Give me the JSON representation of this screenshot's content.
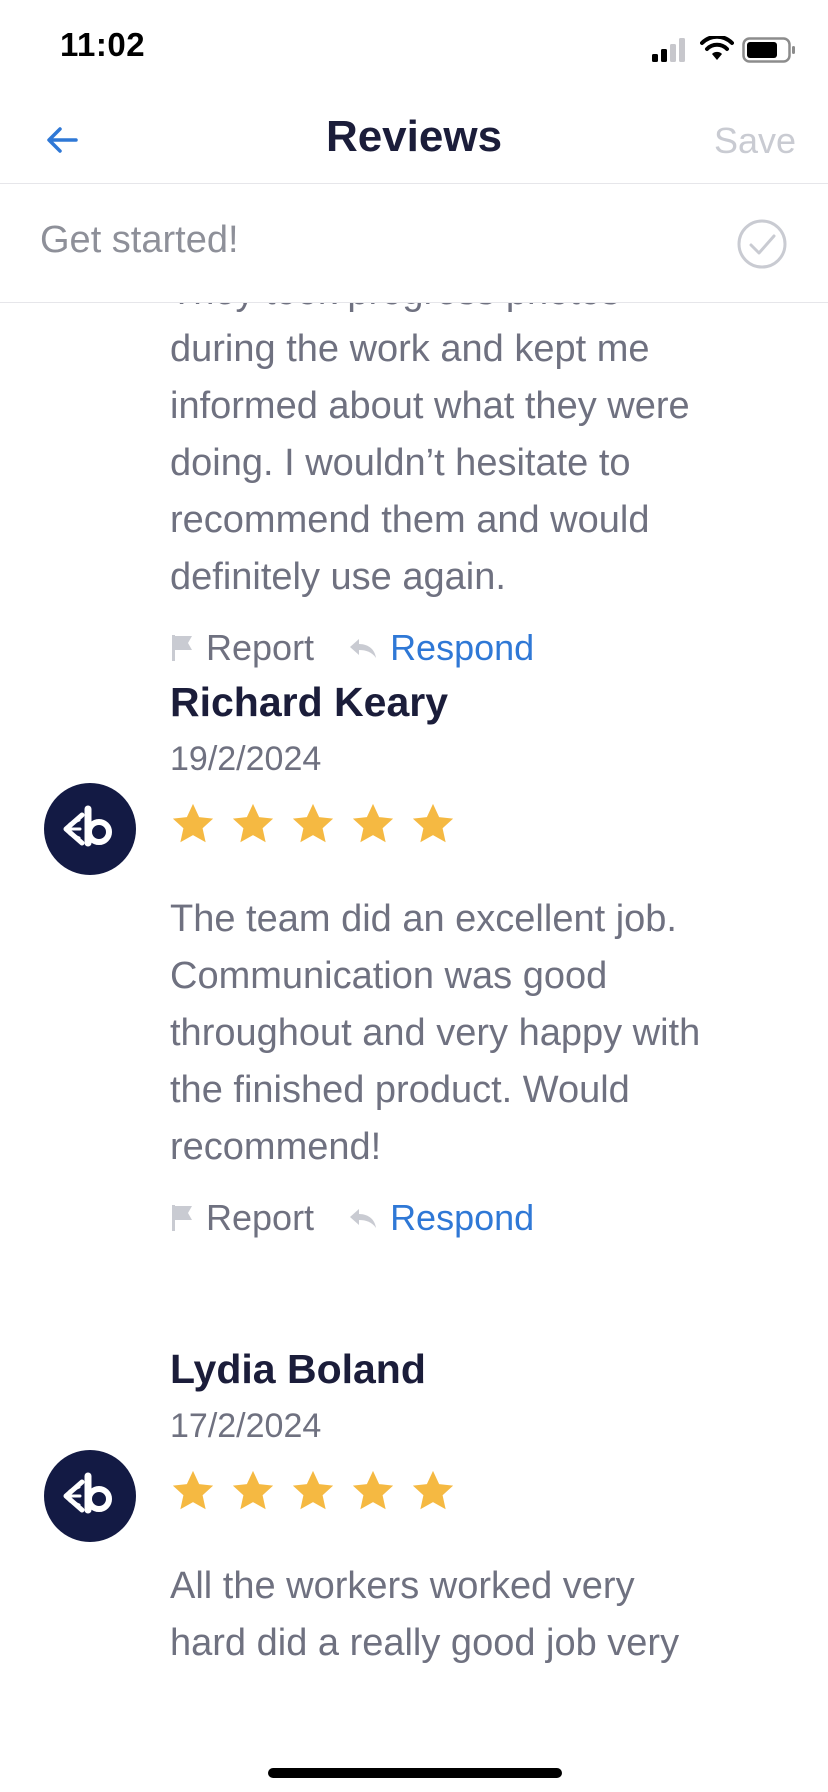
{
  "status_bar": {
    "time": "11:02"
  },
  "nav": {
    "title": "Reviews",
    "save_label": "Save",
    "back_icon": "arrow-left-icon"
  },
  "get_started": {
    "label": "Get started!"
  },
  "colors": {
    "accent": "#2f78d6",
    "title": "#1b1d3a",
    "body_text": "#6f7180",
    "star": "#f5b942",
    "avatar_bg": "#131a44",
    "disabled": "#c9cbd2"
  },
  "reviews": [
    {
      "text_lines": [
        "They took progress photos",
        "during the work and kept me",
        "informed about what they were",
        "doing. I wouldn’t hesitate to",
        "recommend them and would",
        "definitely use again."
      ],
      "report_label": "Report",
      "respond_label": "Respond"
    },
    {
      "name": "Richard Keary",
      "date": "19/2/2024",
      "rating": 5,
      "text_lines": [
        "The team did an excellent job.",
        "Communication was good",
        "throughout and very happy with",
        "the finished product. Would",
        "recommend!"
      ],
      "report_label": "Report",
      "respond_label": "Respond"
    },
    {
      "name": "Lydia Boland",
      "date": "17/2/2024",
      "rating": 5,
      "text_lines": [
        "All the workers worked very",
        "hard did a really good job very"
      ]
    }
  ]
}
